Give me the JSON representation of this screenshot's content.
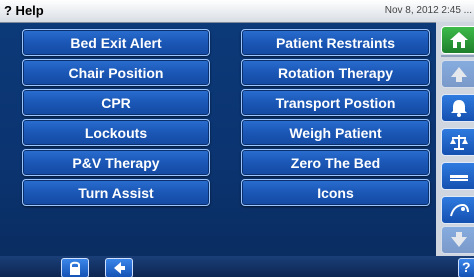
{
  "header": {
    "title": "? Help",
    "datetime": "Nov 8, 2012 2:45 ..."
  },
  "topics": [
    "Bed Exit Alert",
    "Patient Restraints",
    "Chair Position",
    "Rotation Therapy",
    "CPR",
    "Transport Postion",
    "Lockouts",
    "Weigh Patient",
    "P&V Therapy",
    "Zero The Bed",
    "Turn Assist",
    "Icons"
  ],
  "icons": {
    "side_rail": [
      "home-icon",
      "arrow-up-icon",
      "bell-icon",
      "scale-icon",
      "bed-icon",
      "patient-icon",
      "arrow-down-icon"
    ],
    "bottom_bar": [
      "lock-icon",
      "arrow-left-icon",
      "help-icon"
    ]
  },
  "colors": {
    "background": "#0b3470",
    "button": "#1c59b8",
    "home_button": "#3dbb4a",
    "title_bar": "#ffffff"
  }
}
